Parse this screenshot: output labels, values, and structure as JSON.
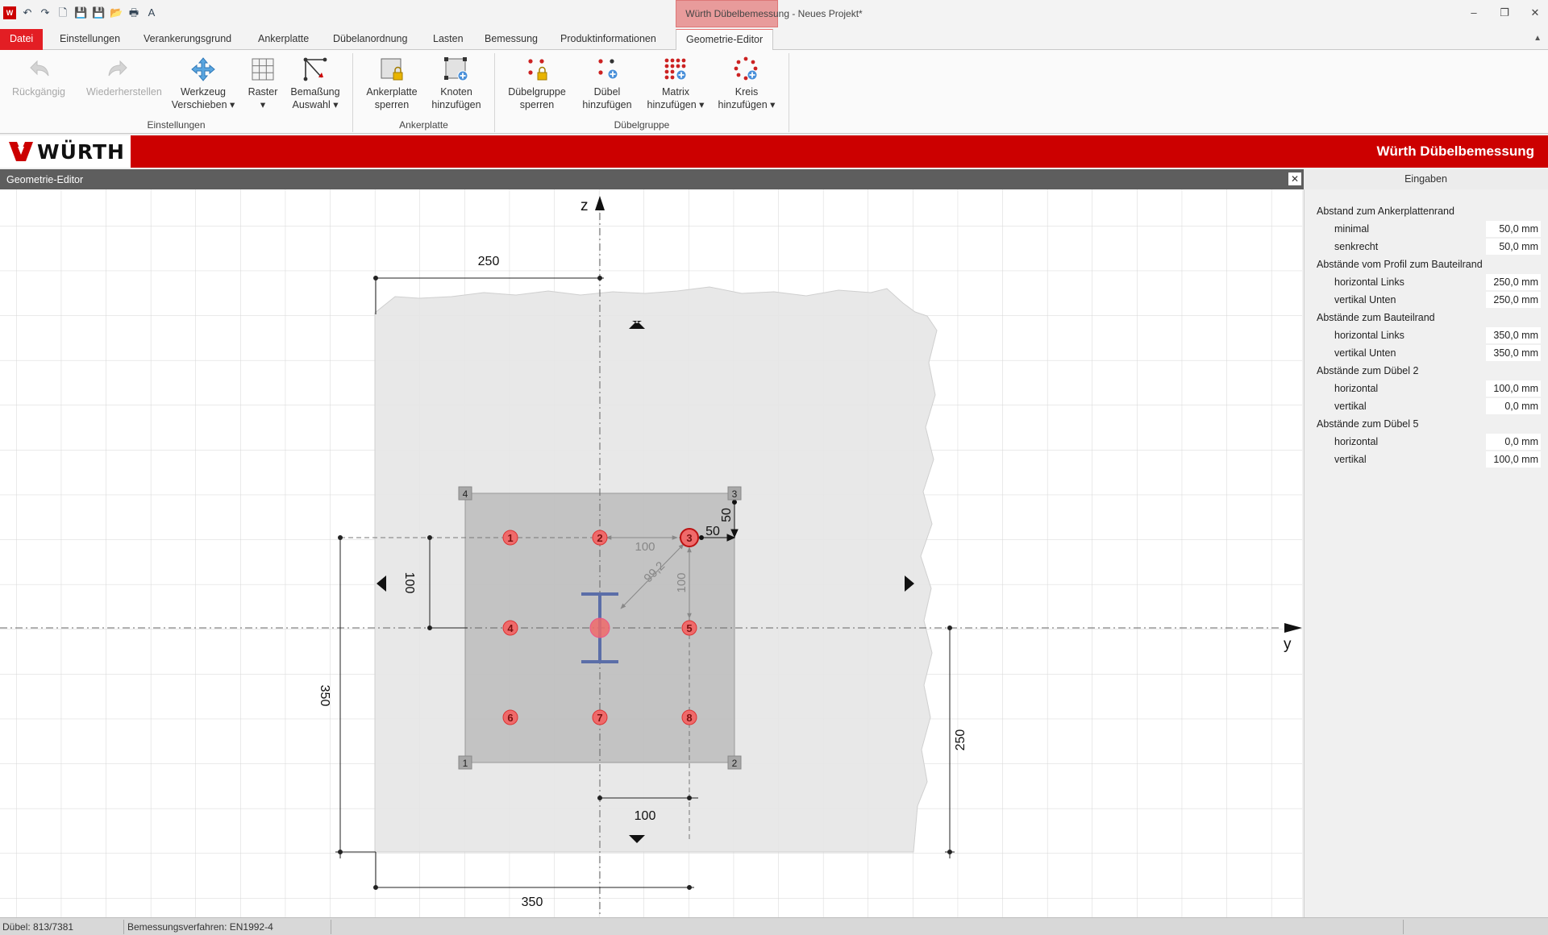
{
  "window": {
    "title": "Würth Dübelbemessung - Neues Projekt*",
    "minimize": "–",
    "restore": "❐",
    "close": "✕"
  },
  "quick_access": [
    "↶",
    "↷",
    "🗋",
    "💾",
    "💾",
    "📂",
    "🖶",
    "A"
  ],
  "tabs": [
    {
      "label": "Datei"
    },
    {
      "label": "Einstellungen"
    },
    {
      "label": "Verankerungsgrund"
    },
    {
      "label": "Ankerplatte"
    },
    {
      "label": "Dübelanordnung"
    },
    {
      "label": "Lasten"
    },
    {
      "label": "Bemessung"
    },
    {
      "label": "Produktinformationen"
    },
    {
      "label": "Geometrie-Editor"
    }
  ],
  "ribbon": {
    "groups": [
      {
        "label": "Einstellungen"
      },
      {
        "label": "Ankerplatte"
      },
      {
        "label": "Dübelgruppe"
      }
    ],
    "buttons": {
      "undo": {
        "line1": "Rückgängig",
        "line2": ""
      },
      "redo": {
        "line1": "Wiederherstellen",
        "line2": ""
      },
      "move": {
        "line1": "Werkzeug",
        "line2": "Verschieben ▾"
      },
      "grid": {
        "line1": "Raster",
        "line2": "▾"
      },
      "dim": {
        "line1": "Bemaßung",
        "line2": "Auswahl ▾"
      },
      "lockplate": {
        "line1": "Ankerplatte",
        "line2": "sperren"
      },
      "addnode": {
        "line1": "Knoten",
        "line2": "hinzufügen"
      },
      "lockgroup": {
        "line1": "Dübelgruppe",
        "line2": "sperren"
      },
      "adddowel": {
        "line1": "Dübel",
        "line2": "hinzufügen"
      },
      "matrix": {
        "line1": "Matrix",
        "line2": "hinzufügen ▾"
      },
      "circle": {
        "line1": "Kreis",
        "line2": "hinzufügen ▾"
      }
    }
  },
  "brand": {
    "logo": "WÜRTH",
    "product": "Würth Dübelbemessung"
  },
  "panel": {
    "title": "Geometrie-Editor",
    "close": "✕",
    "inputs_title": "Eingaben"
  },
  "canvas": {
    "axis_z": "z",
    "axis_y": "y",
    "dimensions": {
      "top": "250",
      "left_outer": "350",
      "left_inner": "100",
      "bottom_outer": "350",
      "bottom_inner": "100",
      "right": "250",
      "edge_h": "50",
      "edge_v": "50",
      "spacing_h": "100",
      "spacing_v": "100",
      "diagonal": "99,2"
    },
    "corners": [
      "1",
      "2",
      "3",
      "4"
    ],
    "dowels": [
      "1",
      "2",
      "3",
      "4",
      "5",
      "6",
      "7",
      "8"
    ]
  },
  "inputs": [
    {
      "label": "Abstand zum Ankerplattenrand",
      "value": "",
      "indent": false
    },
    {
      "label": "minimal",
      "value": "50,0 mm",
      "indent": true
    },
    {
      "label": "senkrecht",
      "value": "50,0 mm",
      "indent": true
    },
    {
      "label": "Abstände vom Profil zum Bauteilrand",
      "value": "",
      "indent": false
    },
    {
      "label": "horizontal Links",
      "value": "250,0 mm",
      "indent": true
    },
    {
      "label": "vertikal Unten",
      "value": "250,0 mm",
      "indent": true
    },
    {
      "label": "Abstände zum Bauteilrand",
      "value": "",
      "indent": false
    },
    {
      "label": "horizontal Links",
      "value": "350,0 mm",
      "indent": true
    },
    {
      "label": "vertikal Unten",
      "value": "350,0 mm",
      "indent": true
    },
    {
      "label": "Abstände zum Dübel 2",
      "value": "",
      "indent": false
    },
    {
      "label": "horizontal",
      "value": "100,0 mm",
      "indent": true
    },
    {
      "label": "vertikal",
      "value": "0,0 mm",
      "indent": true
    },
    {
      "label": "Abstände zum Dübel 5",
      "value": "",
      "indent": false
    },
    {
      "label": "horizontal",
      "value": "0,0 mm",
      "indent": true
    },
    {
      "label": "vertikal",
      "value": "100,0 mm",
      "indent": true
    }
  ],
  "status": {
    "dowel": "Dübel: 813/7381",
    "method": "Bemessungsverfahren: EN1992-4"
  },
  "colors": {
    "brand_red": "#cc0000",
    "file_tab": "#e31e24",
    "dowel_fill": "#ef6a6a",
    "plate": "#bdbdbd",
    "concrete": "#e6e6e6",
    "profile": "#5b6ea8"
  }
}
